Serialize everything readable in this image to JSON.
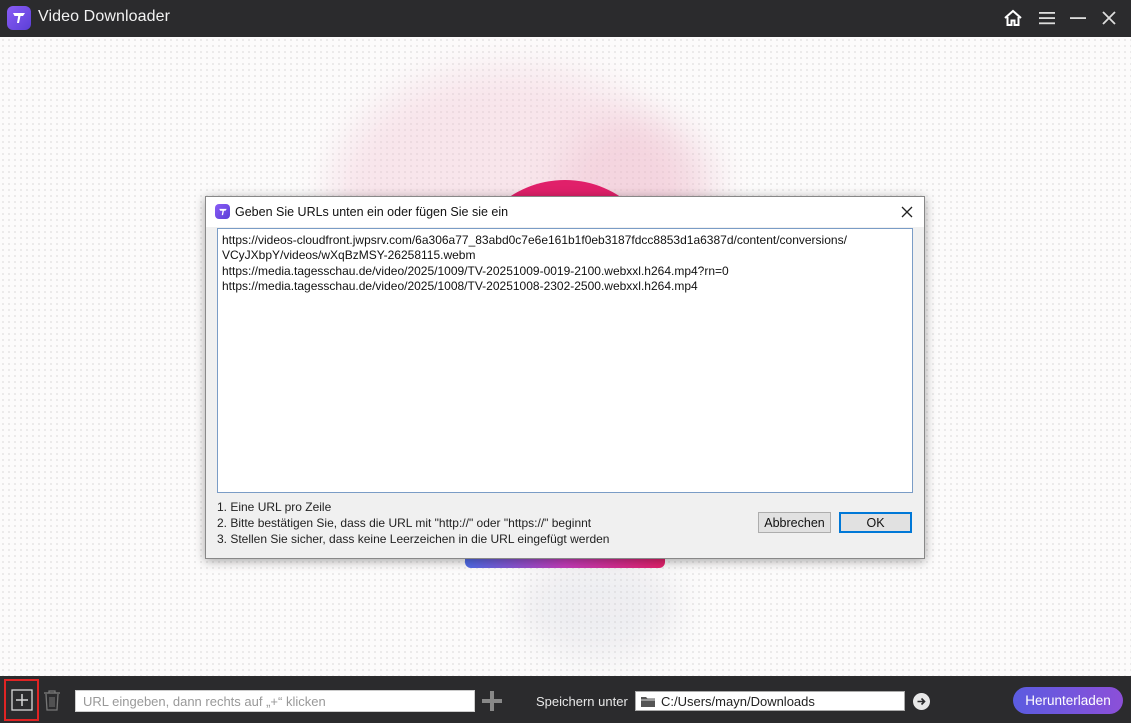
{
  "app": {
    "title": "Video Downloader"
  },
  "titlebar": {
    "icons": [
      "home-icon",
      "menu-icon",
      "minimize-icon",
      "close-icon"
    ]
  },
  "dialog": {
    "title": "Geben Sie URLs unten ein oder fügen Sie sie ein",
    "url_lines": [
      "https://videos-cloudfront.jwpsrv.com/6a306a77_83abd0c7e6e161b1f0eb3187fdcc8853d1a6387d/content/conversions/",
      "VCyJXbpY/videos/wXqBzMSY-26258115.webm",
      "https://media.tagesschau.de/video/2025/1009/TV-20251009-0019-2100.webxxl.h264.mp4?rn=0",
      "https://media.tagesschau.de/video/2025/1008/TV-20251008-2302-2500.webxxl.h264.mp4"
    ],
    "hints": [
      "1. Eine URL pro Zeile",
      "2. Bitte bestätigen Sie, dass die URL mit \"http://\" oder \"https://\" beginnt",
      "3. Stellen Sie sicher, dass keine Leerzeichen in die URL eingefügt werden"
    ],
    "cancel_label": "Abbrechen",
    "ok_label": "OK"
  },
  "bottombar": {
    "url_placeholder": "URL eingeben, dann rechts auf „+“ klicken",
    "save_label": "Speichern unter",
    "save_path": "C:/Users/mayn/Downloads",
    "download_label": "Herunterladen"
  },
  "colors": {
    "titlebar_bg": "#2b2b2d",
    "accent_purple": "#6a4be0",
    "highlight_red": "#e02424",
    "pink": "#e0206a"
  }
}
